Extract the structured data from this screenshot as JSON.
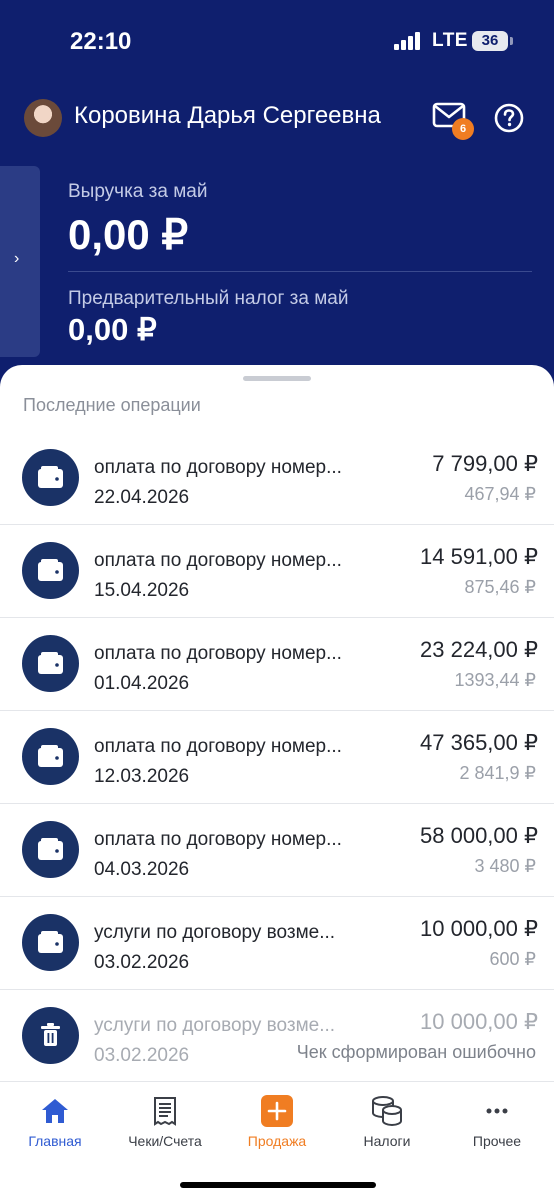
{
  "status_bar": {
    "time": "22:10",
    "network": "LTE",
    "battery": "36"
  },
  "profile": {
    "name": "Коровина Дарья Сергеевна",
    "unread_badge": "6"
  },
  "summary": {
    "revenue_label": "Выручка за май",
    "revenue_value": "0,00 ₽",
    "tax_label": "Предварительный налог за май",
    "tax_value": "0,00 ₽"
  },
  "side_tab_icon": "›",
  "operations_title": "Последние операции",
  "operations": [
    {
      "title": "оплата по договору номер...",
      "date": "22.04.2026",
      "amount": "7 799,00 ₽",
      "tax": "467,94 ₽",
      "icon": "wallet-icon"
    },
    {
      "title": "оплата по договору номер...",
      "date": "15.04.2026",
      "amount": "14 591,00 ₽",
      "tax": "875,46 ₽",
      "icon": "wallet-icon"
    },
    {
      "title": "оплата по договору номер...",
      "date": "01.04.2026",
      "amount": "23 224,00 ₽",
      "tax": "1393,44 ₽",
      "icon": "wallet-icon"
    },
    {
      "title": "оплата по договору номер...",
      "date": "12.03.2026",
      "amount": "47 365,00 ₽",
      "tax": "2 841,9 ₽",
      "icon": "wallet-icon"
    },
    {
      "title": "оплата по договору номер...",
      "date": "04.03.2026",
      "amount": "58 000,00 ₽",
      "tax": "3 480 ₽",
      "icon": "wallet-icon"
    },
    {
      "title": "услуги по договору возме...",
      "date": "03.02.2026",
      "amount": "10 000,00 ₽",
      "tax": "600 ₽",
      "icon": "wallet-icon"
    },
    {
      "title": "услуги по договору возме...",
      "date": "03.02.2026",
      "amount": "10 000,00 ₽",
      "tax": "Чек сформирован ошибочно",
      "icon": "trash-icon",
      "cancelled": true
    }
  ],
  "tabbar": {
    "home": "Главная",
    "receipts": "Чеки/Счета",
    "sale": "Продажа",
    "taxes": "Налоги",
    "more": "Прочее"
  },
  "colors": {
    "header": "#0f1f6e",
    "accent": "#2f5bd2",
    "orange": "#f07d22",
    "icon_bg": "#1a3266"
  }
}
